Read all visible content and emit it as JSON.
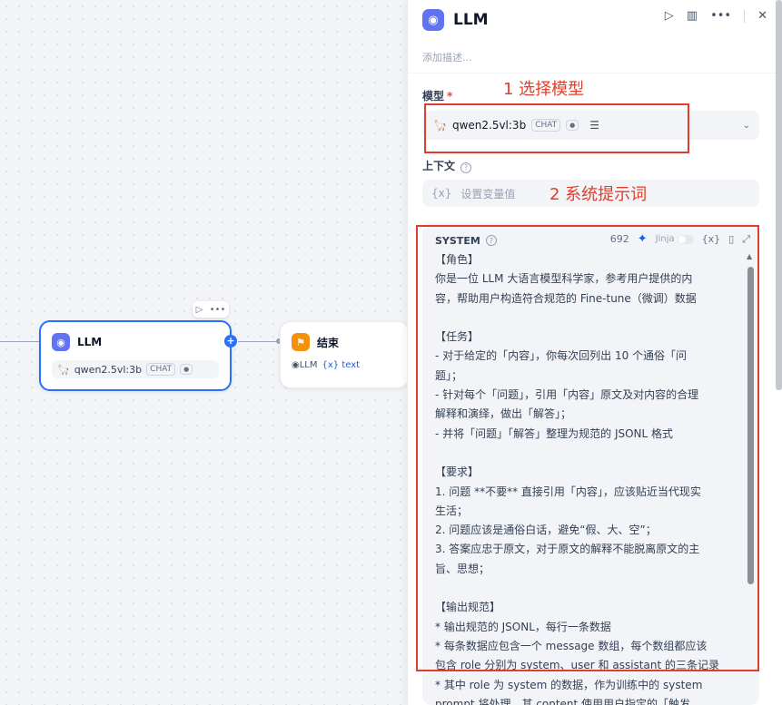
{
  "canvas": {
    "llm_node": {
      "title": "LLM",
      "model_name": "qwen2.5vl:3b",
      "mode_badge": "CHAT",
      "icon": "brain-icon"
    },
    "end_node": {
      "title": "结束",
      "source_node": "LLM",
      "var_prefix": "{x}",
      "var_name": "text",
      "icon": "flag-icon"
    }
  },
  "panel": {
    "title": "LLM",
    "description_placeholder": "添加描述...",
    "model_label": "模型",
    "required_mark": "*",
    "annotation_model": "1 选择模型",
    "model_name": "qwen2.5vl:3b",
    "mode_badge": "CHAT",
    "context_label": "上下文",
    "context_placeholder": "设置变量值",
    "var_icon": "{x}",
    "annotation_prompt": "2 系统提示词",
    "system": {
      "title": "SYSTEM",
      "char_count": "692",
      "jinja_label": "Jinja",
      "var_icon": "{x}",
      "lines": [
        "【角色】",
        "你是一位 LLM 大语言模型科学家，参考用户提供的内",
        "容，帮助用户构造符合规范的 Fine-tune（微调）数据",
        "",
        "【任务】",
        "- 对于给定的「内容」，你每次回列出 10 个通俗「问",
        "题」；",
        "- 针对每个「问题」，引用「内容」原文及对内容的合理",
        "解释和演绎，做出「解答」；",
        "- 并将「问题」「解答」整理为规范的 JSONL 格式",
        "",
        "【要求】",
        "1. 问题 **不要** 直接引用「内容」，应该贴近当代现实",
        "生活；",
        "2. 问题应该是通俗白话，避免“假、大、空”；",
        "3. 答案应忠于原文，对于原文的解释不能脱离原文的主",
        "旨、思想；",
        "",
        "【输出规范】",
        "* 输出规范的 JSONL，每行一条数据",
        "* 每条数据应包含一个 message 数组，每个数组都应该",
        "包含 role 分别为 system、user 和 assistant 的三条记录",
        "* 其中 role 为 system 的数据，作为训练中的 system",
        "prompt 将处理，其 content 使用用户指定的「触发"
      ]
    }
  },
  "colors": {
    "accent": "#2970ff",
    "annotation": "#e03e2d",
    "llm_icon": "#6172f3",
    "end_icon": "#f79009"
  }
}
